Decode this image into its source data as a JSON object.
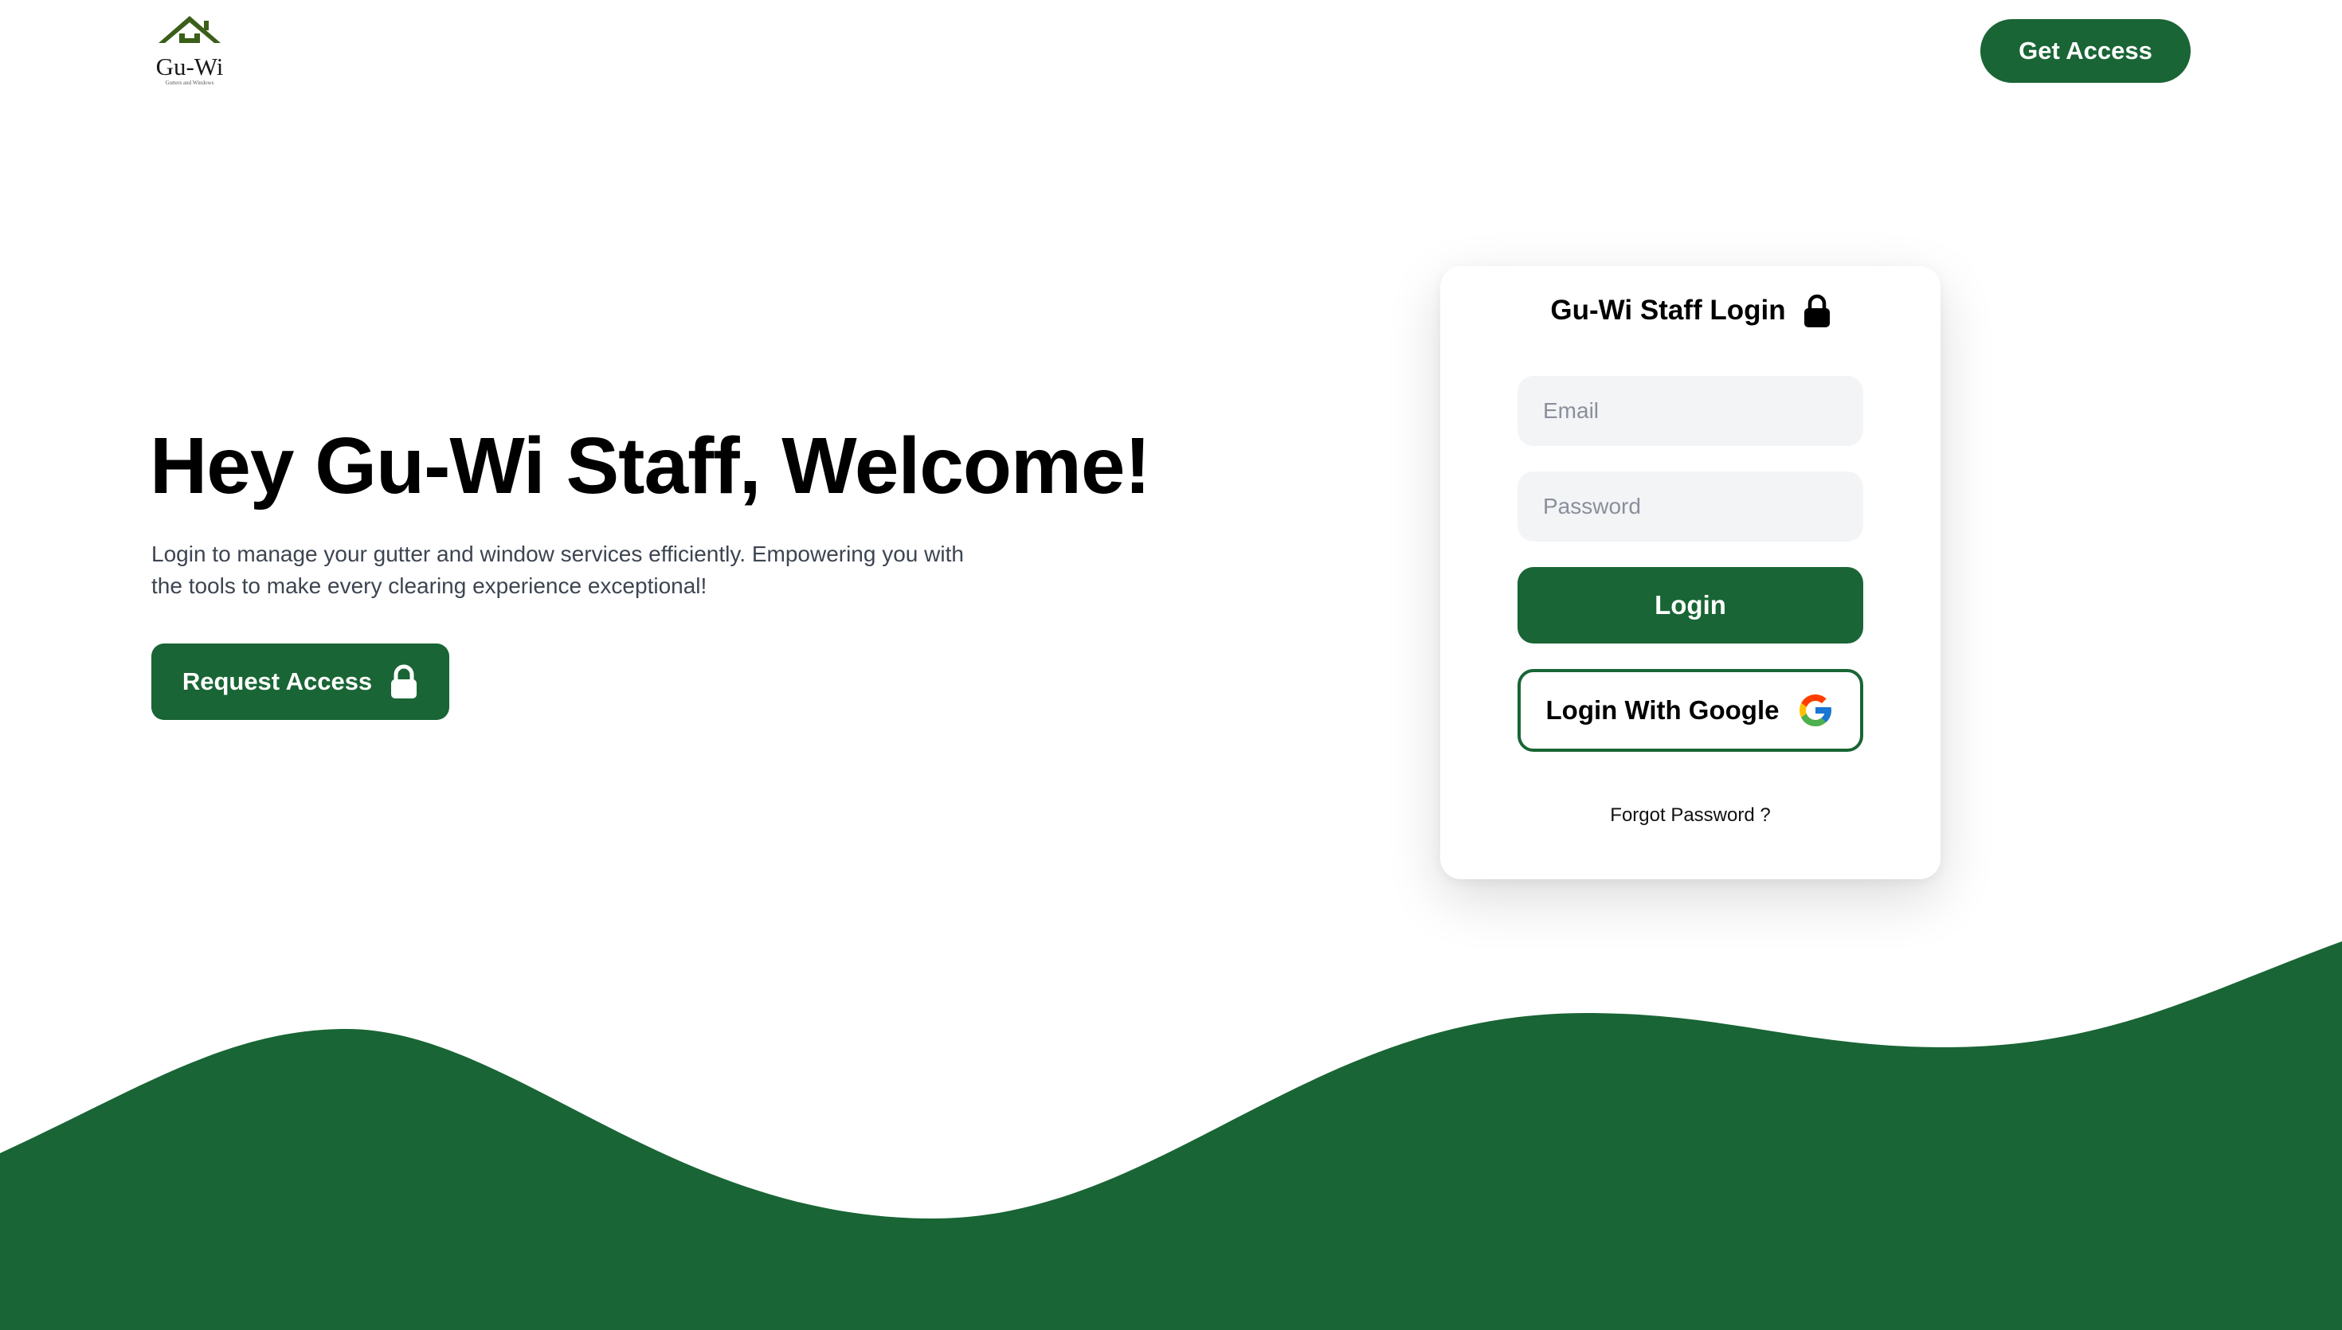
{
  "colors": {
    "brand_green": "#196535",
    "logo_green": "#3b5e19",
    "input_bg": "#f3f4f6",
    "text_muted": "#3d4551"
  },
  "header": {
    "logo": {
      "name": "Gu-Wi",
      "tagline": "Gutters and Windows",
      "icon": "house-roof-icon"
    },
    "get_access_label": "Get Access"
  },
  "hero": {
    "title": "Hey Gu-Wi Staff, Welcome!",
    "description": "Login to manage your gutter and window services efficiently. Empowering you with the tools to make every clearing experience exceptional!",
    "request_access_label": "Request Access",
    "request_access_icon": "lock-icon"
  },
  "login_card": {
    "title": "Gu-Wi Staff Login",
    "title_icon": "lock-icon",
    "email_placeholder": "Email",
    "password_placeholder": "Password",
    "login_label": "Login",
    "google_label": "Login With Google",
    "google_icon": "google-icon",
    "forgot_label": "Forgot Password ?"
  }
}
